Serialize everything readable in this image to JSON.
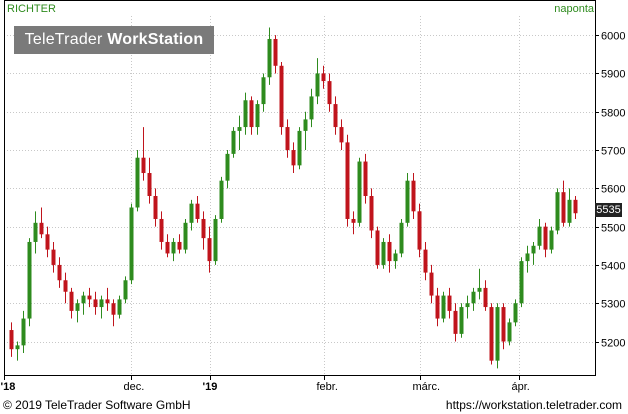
{
  "header": {
    "symbol": "RICHTER",
    "interval": "naponta",
    "logo_part1": "TeleTrader",
    "logo_part2": "WorkStation"
  },
  "last_price": "5535",
  "footer": {
    "copyright": "© 2019 TeleTrader Software GmbH",
    "url": "https://workstation.teletrader.com"
  },
  "colors": {
    "up": "#2e8b1e",
    "down": "#c0141c",
    "grid": "#c8c8c8",
    "frame": "#000000",
    "accent": "#2e8b1e"
  },
  "chart_data": {
    "type": "candlestick",
    "title": "",
    "xlabel": "",
    "ylabel": "",
    "ylim": [
      5110,
      6050
    ],
    "y_ticks": [
      5200,
      5300,
      5400,
      5500,
      5600,
      5700,
      5800,
      5900,
      6000
    ],
    "x_ticks": [
      "'18",
      "dec.",
      "'19",
      "febr.",
      "márc.",
      "ápr."
    ],
    "grid": true,
    "price_axis": "right",
    "candles": [
      [
        5230,
        5250,
        5160,
        5180
      ],
      [
        5180,
        5200,
        5150,
        5190
      ],
      [
        5190,
        5280,
        5170,
        5260
      ],
      [
        5260,
        5470,
        5240,
        5460
      ],
      [
        5460,
        5540,
        5430,
        5510
      ],
      [
        5510,
        5550,
        5470,
        5480
      ],
      [
        5480,
        5500,
        5420,
        5440
      ],
      [
        5440,
        5460,
        5380,
        5400
      ],
      [
        5400,
        5420,
        5340,
        5360
      ],
      [
        5360,
        5380,
        5300,
        5330
      ],
      [
        5330,
        5340,
        5260,
        5280
      ],
      [
        5280,
        5310,
        5250,
        5300
      ],
      [
        5300,
        5330,
        5270,
        5320
      ],
      [
        5320,
        5340,
        5290,
        5310
      ],
      [
        5310,
        5330,
        5270,
        5290
      ],
      [
        5290,
        5320,
        5260,
        5310
      ],
      [
        5310,
        5340,
        5280,
        5300
      ],
      [
        5300,
        5310,
        5240,
        5270
      ],
      [
        5270,
        5320,
        5260,
        5310
      ],
      [
        5310,
        5370,
        5300,
        5360
      ],
      [
        5360,
        5560,
        5350,
        5550
      ],
      [
        5550,
        5700,
        5540,
        5680
      ],
      [
        5680,
        5760,
        5620,
        5640
      ],
      [
        5640,
        5680,
        5560,
        5580
      ],
      [
        5580,
        5600,
        5500,
        5520
      ],
      [
        5520,
        5540,
        5440,
        5460
      ],
      [
        5460,
        5480,
        5420,
        5430
      ],
      [
        5430,
        5470,
        5410,
        5460
      ],
      [
        5460,
        5480,
        5430,
        5440
      ],
      [
        5440,
        5520,
        5430,
        5510
      ],
      [
        5510,
        5570,
        5490,
        5560
      ],
      [
        5560,
        5580,
        5510,
        5520
      ],
      [
        5520,
        5540,
        5440,
        5470
      ],
      [
        5470,
        5500,
        5380,
        5410
      ],
      [
        5410,
        5530,
        5400,
        5520
      ],
      [
        5520,
        5630,
        5510,
        5620
      ],
      [
        5620,
        5700,
        5600,
        5690
      ],
      [
        5690,
        5760,
        5680,
        5750
      ],
      [
        5750,
        5790,
        5700,
        5760
      ],
      [
        5760,
        5850,
        5740,
        5830
      ],
      [
        5830,
        5840,
        5740,
        5760
      ],
      [
        5760,
        5830,
        5740,
        5820
      ],
      [
        5820,
        5900,
        5800,
        5890
      ],
      [
        5890,
        6020,
        5870,
        5990
      ],
      [
        5990,
        6000,
        5900,
        5920
      ],
      [
        5920,
        5930,
        5740,
        5760
      ],
      [
        5760,
        5780,
        5680,
        5700
      ],
      [
        5700,
        5720,
        5640,
        5660
      ],
      [
        5660,
        5760,
        5650,
        5750
      ],
      [
        5750,
        5800,
        5700,
        5780
      ],
      [
        5780,
        5860,
        5760,
        5840
      ],
      [
        5840,
        5940,
        5820,
        5900
      ],
      [
        5900,
        5920,
        5860,
        5880
      ],
      [
        5880,
        5900,
        5800,
        5820
      ],
      [
        5820,
        5840,
        5740,
        5760
      ],
      [
        5760,
        5780,
        5700,
        5720
      ],
      [
        5720,
        5740,
        5500,
        5520
      ],
      [
        5520,
        5540,
        5480,
        5510
      ],
      [
        5510,
        5680,
        5500,
        5670
      ],
      [
        5670,
        5690,
        5560,
        5580
      ],
      [
        5580,
        5600,
        5470,
        5490
      ],
      [
        5490,
        5500,
        5390,
        5400
      ],
      [
        5400,
        5470,
        5390,
        5460
      ],
      [
        5460,
        5480,
        5380,
        5410
      ],
      [
        5410,
        5440,
        5390,
        5430
      ],
      [
        5430,
        5520,
        5420,
        5510
      ],
      [
        5510,
        5640,
        5500,
        5620
      ],
      [
        5620,
        5640,
        5520,
        5540
      ],
      [
        5540,
        5560,
        5420,
        5440
      ],
      [
        5440,
        5460,
        5360,
        5380
      ],
      [
        5380,
        5400,
        5300,
        5320
      ],
      [
        5320,
        5340,
        5240,
        5260
      ],
      [
        5260,
        5330,
        5250,
        5320
      ],
      [
        5320,
        5340,
        5260,
        5280
      ],
      [
        5280,
        5300,
        5200,
        5220
      ],
      [
        5220,
        5300,
        5210,
        5290
      ],
      [
        5290,
        5320,
        5260,
        5300
      ],
      [
        5300,
        5340,
        5280,
        5330
      ],
      [
        5330,
        5390,
        5310,
        5340
      ],
      [
        5340,
        5360,
        5280,
        5290
      ],
      [
        5290,
        5300,
        5140,
        5150
      ],
      [
        5150,
        5300,
        5130,
        5290
      ],
      [
        5290,
        5300,
        5180,
        5200
      ],
      [
        5200,
        5260,
        5190,
        5250
      ],
      [
        5250,
        5310,
        5240,
        5300
      ],
      [
        5300,
        5420,
        5290,
        5410
      ],
      [
        5410,
        5450,
        5380,
        5430
      ],
      [
        5430,
        5460,
        5400,
        5450
      ],
      [
        5450,
        5520,
        5440,
        5500
      ],
      [
        5500,
        5510,
        5420,
        5440
      ],
      [
        5440,
        5500,
        5430,
        5490
      ],
      [
        5490,
        5600,
        5480,
        5590
      ],
      [
        5590,
        5620,
        5500,
        5510
      ],
      [
        5510,
        5600,
        5500,
        5570
      ],
      [
        5570,
        5580,
        5520,
        5535
      ]
    ]
  }
}
